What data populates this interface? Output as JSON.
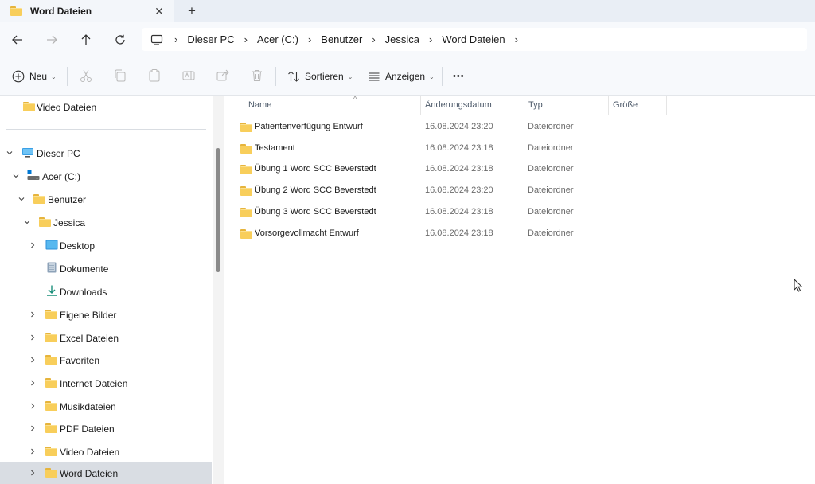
{
  "tab": {
    "title": "Word Dateien",
    "close_glyph": "✕",
    "new_tab_glyph": "+"
  },
  "breadcrumb": [
    "Dieser PC",
    "Acer (C:)",
    "Benutzer",
    "Jessica",
    "Word Dateien"
  ],
  "commands": {
    "new_label": "Neu",
    "sort_label": "Sortieren",
    "view_label": "Anzeigen",
    "more_glyph": "•••"
  },
  "sidebar": {
    "quick_item": "Video Dateien",
    "tree": [
      {
        "label": "Dieser PC",
        "icon": "pc-icon",
        "expanded": true
      },
      {
        "label": "Acer (C:)",
        "icon": "drive-icon",
        "expanded": true
      },
      {
        "label": "Benutzer",
        "icon": "folder-icon",
        "expanded": true
      },
      {
        "label": "Jessica",
        "icon": "folder-icon",
        "expanded": true
      },
      {
        "label": "Desktop",
        "icon": "desktop-icon",
        "expanded": false
      },
      {
        "label": "Dokumente",
        "icon": "documents-icon",
        "expanded": false
      },
      {
        "label": "Downloads",
        "icon": "downloads-icon",
        "expanded": false
      },
      {
        "label": "Eigene Bilder",
        "icon": "folder-icon",
        "expanded": false
      },
      {
        "label": "Excel Dateien",
        "icon": "folder-icon",
        "expanded": false
      },
      {
        "label": "Favoriten",
        "icon": "folder-icon",
        "expanded": false
      },
      {
        "label": "Internet Dateien",
        "icon": "folder-icon",
        "expanded": false
      },
      {
        "label": "Musikdateien",
        "icon": "folder-icon",
        "expanded": false
      },
      {
        "label": "PDF Dateien",
        "icon": "folder-icon",
        "expanded": false
      },
      {
        "label": "Video Dateien",
        "icon": "folder-icon",
        "expanded": false
      },
      {
        "label": "Word Dateien",
        "icon": "folder-icon",
        "expanded": false,
        "selected": true
      }
    ]
  },
  "columns": [
    "Name",
    "Änderungsdatum",
    "Typ",
    "Größe"
  ],
  "files": [
    {
      "name": "Patientenverfügung Entwurf",
      "date": "16.08.2024 23:20",
      "type": "Dateiordner"
    },
    {
      "name": "Testament",
      "date": "16.08.2024 23:18",
      "type": "Dateiordner"
    },
    {
      "name": "Übung 1 Word SCC Beverstedt",
      "date": "16.08.2024 23:18",
      "type": "Dateiordner"
    },
    {
      "name": "Übung 2 Word SCC Beverstedt",
      "date": "16.08.2024 23:20",
      "type": "Dateiordner"
    },
    {
      "name": "Übung 3 Word SCC Beverstedt",
      "date": "16.08.2024 23:18",
      "type": "Dateiordner"
    },
    {
      "name": "Vorsorgevollmacht Entwurf",
      "date": "16.08.2024 23:18",
      "type": "Dateiordner"
    }
  ],
  "colors": {
    "folder": "#f8ce5b",
    "accent": "#0067c0",
    "selected_row": "#d9dde3"
  }
}
